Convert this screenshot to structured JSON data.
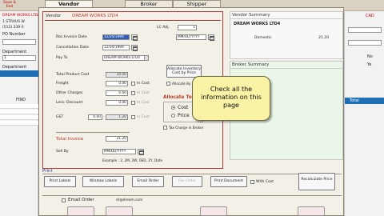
{
  "toolbar": {
    "items": [
      "Save &",
      "End"
    ]
  },
  "background": {
    "vendor_name": "DREAM WORKS LTD4",
    "address_1": "1 STRAUS W",
    "phone": "(513) 339-0",
    "po_number_label": "PO Number",
    "department_label": "Department",
    "department_value": "1",
    "department_2": "1",
    "department_label_2": "Department",
    "grid_label": "FIND",
    "right_label_cad": "CAD",
    "right_label_total": "Total",
    "right_label_no": "No",
    "right_label_ye": "Ye"
  },
  "tabs": [
    {
      "label": "Vendor",
      "active": true
    },
    {
      "label": "Broker",
      "active": false
    },
    {
      "label": "Shipper",
      "active": false
    }
  ],
  "vendor_form": {
    "vendor_label": "Vendor",
    "vendor_value": "DREAM WORKS LTD4",
    "lc_adj_label": "LC Adj.",
    "lc_adj_value": "1",
    "rec_invoice_date_label": "Rec.Invoice Date",
    "rec_invoice_date_value": "12/20/1999",
    "rec_invoice_date_right": "MM/DD/YYYY",
    "cancellation_date_label": "Cancellation Date",
    "cancellation_date_value": "12/30/1999",
    "pay_to_label": "Pay To",
    "pay_to_value": "DREAM WORKS LTD4",
    "allocate_inventory_cost_label": "Allocate Inventory Cost by Price",
    "total_product_cost_label": "Total Product Cost",
    "total_product_cost_value": "20.00",
    "allocate_by_item_label": "Allocate By Item (Pack)",
    "freight_label": "Freight",
    "freight_value": "0.00",
    "freight_in_cost": "In Cost",
    "other_charges_label": "Other Charges",
    "other_charges_value": "0.00",
    "other_charges_in_cost": "In Cost",
    "less_discount_label": "Less: Discount",
    "less_discount_value": "0.00",
    "less_discount_in_cost": "In Cost",
    "allocate_to_cost_by_label": "Allocate To Cost By",
    "radio_cost_label": "Cost",
    "radio_price_label": "Price",
    "gst_label": "GST",
    "gst_rate_value": "0.00",
    "gst_value": "1.20",
    "gst_in_cost": "In Cost",
    "tax_charge_in_broker_label": "Tax Charge in Broker",
    "total_invoice_label": "Total Invoice",
    "total_invoice_value": "21.20",
    "sell_by_label": "Sell By",
    "sell_by_value": "MM/DD/YYYY",
    "example_text": "Example : 2, 2M, 2W, 0ED, 2Y, Date"
  },
  "vendor_summary": {
    "title": "Vendor Summary",
    "vendor_name": "DREAM WORKS LTD4",
    "row_label": "Domestic",
    "row_value": "21.20"
  },
  "broker_summary": {
    "title": "Broker Summary"
  },
  "callout": {
    "text": "Check all the information on this page"
  },
  "print_section": {
    "title": "Print",
    "buttons": [
      "Print Labels",
      "Window Labels",
      "Email Order",
      "Fax Order",
      "Print Document"
    ],
    "with_cost_label": "With Cost",
    "recalculate_label": "Recalculate Price"
  },
  "email_section": {
    "email_order_label": "Email Order",
    "email_address": "dr@dream.com"
  }
}
